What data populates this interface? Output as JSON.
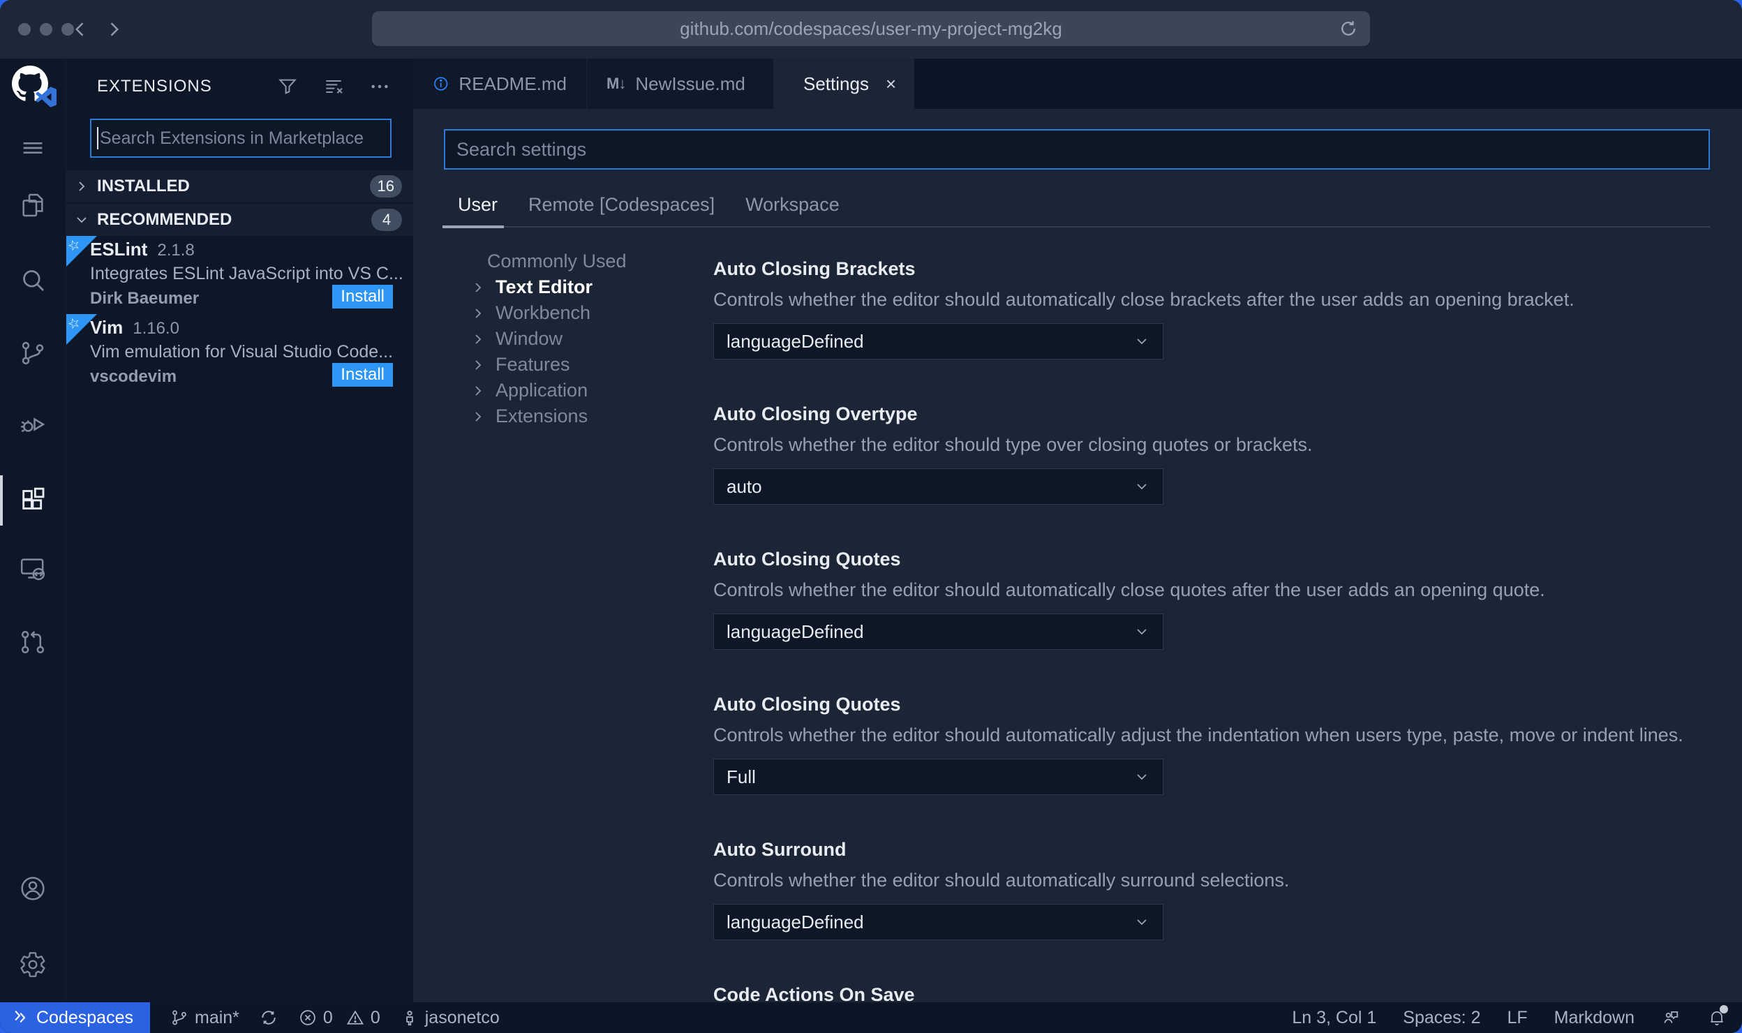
{
  "browser": {
    "url": "github.com/codespaces/user-my-project-mg2kg"
  },
  "activity_bar": {
    "icons": [
      "github-logo",
      "menu",
      "explorer",
      "search",
      "source-control",
      "run-debug",
      "extensions",
      "remote-explorer",
      "pull-requests",
      "account",
      "settings-gear"
    ],
    "active_icon": "extensions"
  },
  "sidebar": {
    "title": "EXTENSIONS",
    "header_icons": [
      "filter-icon",
      "clear-filter-icon",
      "more-actions-icon"
    ],
    "search": {
      "placeholder": "Search Extensions in Marketplace"
    },
    "sections": [
      {
        "label": "INSTALLED",
        "count": "16"
      },
      {
        "label": "RECOMMENDED",
        "count": "4"
      }
    ],
    "extensions": [
      {
        "name": "ESLint",
        "version": "2.1.8",
        "description": "Integrates ESLint JavaScript into VS C...",
        "author": "Dirk Baeumer",
        "action": "Install"
      },
      {
        "name": "Vim",
        "version": "1.16.0",
        "description": "Vim emulation for Visual Studio Code...",
        "author": "vscodevim",
        "action": "Install"
      }
    ]
  },
  "editor": {
    "tabs": [
      {
        "label": "README.md",
        "icon": "info-icon"
      },
      {
        "label": "NewIssue.md",
        "icon": "markdown-icon",
        "glyph": "M↓"
      },
      {
        "label": "Settings",
        "icon": "settings-editor-icon",
        "close": "×"
      }
    ],
    "settings": {
      "search": {
        "placeholder": "Search settings"
      },
      "scopes": [
        {
          "label": "User"
        },
        {
          "label": "Remote [Codespaces]"
        },
        {
          "label": "Workspace"
        }
      ],
      "toc": [
        {
          "label": "Commonly Used"
        },
        {
          "label": "Text Editor"
        },
        {
          "label": "Workbench"
        },
        {
          "label": "Window"
        },
        {
          "label": "Features"
        },
        {
          "label": "Application"
        },
        {
          "label": "Extensions"
        }
      ],
      "items": [
        {
          "title": "Auto Closing Brackets",
          "description": "Controls whether the editor should automatically close brackets after the user adds an opening bracket.",
          "value": "languageDefined"
        },
        {
          "title": "Auto Closing Overtype",
          "description": "Controls whether the editor should type over closing quotes or brackets.",
          "value": "auto"
        },
        {
          "title": "Auto Closing Quotes",
          "description": "Controls whether the editor should automatically close quotes after the user adds an opening quote.",
          "value": "languageDefined"
        },
        {
          "title": "Auto Closing Quotes",
          "description": "Controls whether the editor should automatically adjust the indentation when users type, paste, move or indent lines.",
          "value": "Full"
        },
        {
          "title": "Auto Surround",
          "description": "Controls whether the editor should automatically surround selections.",
          "value": "languageDefined"
        },
        {
          "title": "Code Actions On Save"
        }
      ]
    }
  },
  "status_bar": {
    "remote": "Codespaces",
    "branch": "main*",
    "errors": "0",
    "warnings": "0",
    "user": "jasonetco",
    "cursor": "Ln 3, Col 1",
    "indent": "Spaces: 2",
    "eol": "LF",
    "language": "Markdown"
  },
  "colors": {
    "accent_blue": "#2e96f5",
    "focus_border": "#2b7cda",
    "remote_status_blue": "#2b62e2",
    "editor_bg": "#1c2535",
    "panel_bg": "#0e1727",
    "chrome_bg": "#1e2737"
  }
}
